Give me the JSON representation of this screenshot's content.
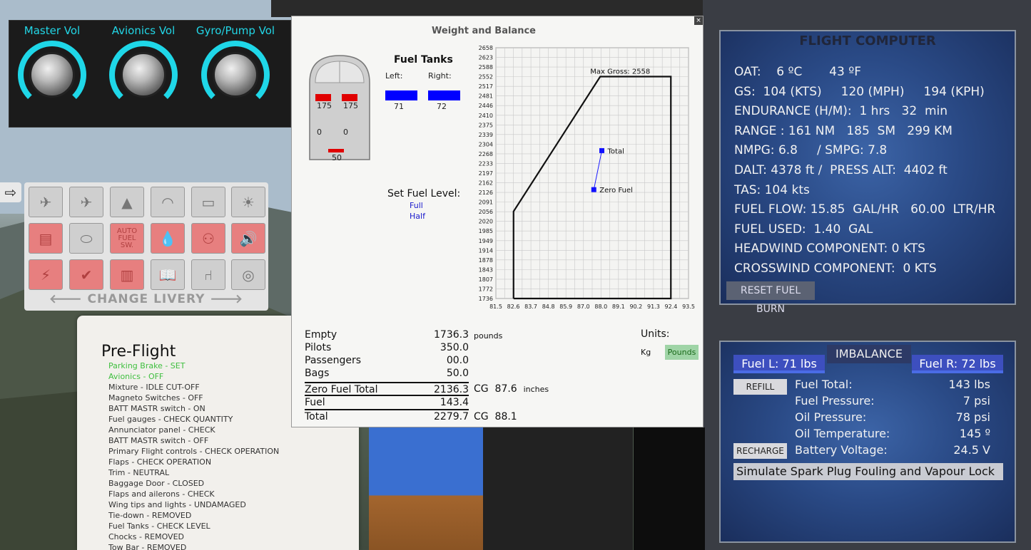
{
  "knobs": [
    {
      "label": "Master Vol"
    },
    {
      "label": "Avionics Vol"
    },
    {
      "label": "Gyro/Pump Vol"
    }
  ],
  "icon_panel": {
    "arrow_tab": "⇨",
    "livery_label": "CHANGE LIVERY",
    "auto_fuel_label": "AUTO\nFUEL\nSW."
  },
  "checklist": {
    "title": "Pre-Flight",
    "items": [
      {
        "text": "Parking Brake - SET",
        "done": true
      },
      {
        "text": "Avionics - OFF",
        "done": true
      },
      {
        "text": "Mixture - IDLE CUT-OFF",
        "done": false
      },
      {
        "text": "Magneto Switches - OFF",
        "done": false
      },
      {
        "text": "BATT MASTR switch - ON",
        "done": false
      },
      {
        "text": "Fuel gauges - CHECK QUANTITY",
        "done": false
      },
      {
        "text": "Annunciator panel - CHECK",
        "done": false
      },
      {
        "text": "BATT MASTR switch - OFF",
        "done": false
      },
      {
        "text": "Primary Flight controls - CHECK OPERATION",
        "done": false
      },
      {
        "text": "Flaps - CHECK OPERATION",
        "done": false
      },
      {
        "text": "Trim - NEUTRAL",
        "done": false
      },
      {
        "text": "Baggage Door - CLOSED",
        "done": false
      },
      {
        "text": "Flaps and ailerons - CHECK",
        "done": false
      },
      {
        "text": "Wing tips and lights - UNDAMAGED",
        "done": false
      },
      {
        "text": "Tie-down - REMOVED",
        "done": false
      },
      {
        "text": "Fuel Tanks - CHECK LEVEL",
        "done": false
      },
      {
        "text": "Chocks - REMOVED",
        "done": false
      },
      {
        "text": "Tow Bar - REMOVED",
        "done": false
      }
    ]
  },
  "wb": {
    "title": "Weight and Balance",
    "close": "×",
    "seats": {
      "pilot_left": "175",
      "pilot_right": "175",
      "pax_left": "0",
      "pax_right": "0",
      "bags": "50"
    },
    "fuel_tanks_title": "Fuel Tanks",
    "left_label": "Left:",
    "right_label": "Right:",
    "left_value": "71",
    "right_value": "72",
    "set_fuel_title": "Set Fuel Level:",
    "full_label": "Full",
    "half_label": "Half",
    "rows": [
      {
        "label": "Empty",
        "value": "1736.3"
      },
      {
        "label": "Pilots",
        "value": "350.0"
      },
      {
        "label": "Passengers",
        "value": "00.0"
      },
      {
        "label": "Bags",
        "value": "50.0"
      },
      {
        "label": "Zero Fuel Total",
        "value": "2136.3"
      },
      {
        "label": "Fuel",
        "value": "143.4"
      },
      {
        "label": "Total",
        "value": "2279.7"
      }
    ],
    "pounds_label": "pounds",
    "cg_label": "CG",
    "zero_fuel_cg": "87.6",
    "inches_label": "inches",
    "total_cg": "88.1",
    "units_label": "Units:",
    "kg_label": "Kg",
    "pounds_button": "Pounds",
    "bar_color": "#0000ff"
  },
  "chart_data": {
    "type": "line",
    "title": "",
    "x_ticks": [
      "81.5",
      "82.6",
      "83.7",
      "84.8",
      "85.9",
      "87.0",
      "88.0",
      "89.1",
      "90.2",
      "91.3",
      "92.4",
      "93.5"
    ],
    "y_ticks": [
      "2658",
      "2623",
      "2588",
      "2552",
      "2517",
      "2481",
      "2446",
      "2410",
      "2375",
      "2339",
      "2304",
      "2268",
      "2233",
      "2197",
      "2162",
      "2126",
      "2091",
      "2056",
      "2020",
      "1985",
      "1949",
      "1914",
      "1878",
      "1843",
      "1807",
      "1772",
      "1736"
    ],
    "xlim": [
      81.5,
      93.5
    ],
    "ylim": [
      1736,
      2658
    ],
    "envelope": {
      "x": [
        82.6,
        82.6,
        88.0,
        92.4,
        92.4,
        82.6
      ],
      "y": [
        1736,
        2056,
        2552,
        2552,
        1736,
        1736
      ]
    },
    "envelope_label": "Max Gross: 2558",
    "points": [
      {
        "name": "Total",
        "x": 88.1,
        "y": 2279.7
      },
      {
        "name": "Zero Fuel",
        "x": 87.6,
        "y": 2136.3
      }
    ],
    "grid": true
  },
  "flight_computer": {
    "title": "FLIGHT COMPUTER",
    "lines": [
      "OAT:    6 ºC       43 ºF",
      "GS:  104 (KTS)     120 (MPH)     194 (KPH)",
      "ENDURANCE (H/M):  1 hrs   32  min",
      "RANGE : 161 NM   185  SM   299 KM",
      "NMPG: 6.8     / SMPG: 7.8",
      "DALT: 4378 ft /  PRESS ALT:  4402 ft",
      "TAS: 104 kts",
      "FUEL FLOW: 15.85  GAL/HR   60.00  LTR/HR",
      "FUEL USED:  1.40  GAL",
      "HEADWIND COMPONENT: 0 KTS",
      "CROSSWIND COMPONENT:  0 KTS"
    ],
    "reset_button": "RESET FUEL BURN"
  },
  "engine": {
    "imbalance": "IMBALANCE",
    "fuel_left": "Fuel L: 71 lbs",
    "fuel_right": "Fuel R: 72 lbs",
    "refill": "REFILL",
    "recharge": "RECHARGE",
    "rows": [
      {
        "label": "Fuel Total:",
        "value": "143 lbs"
      },
      {
        "label": "Fuel Pressure:",
        "value": "7 psi"
      },
      {
        "label": "Oil Pressure:",
        "value": "78 psi"
      },
      {
        "label": "Oil Temperature:",
        "value": "145 º"
      },
      {
        "label": "Battery Voltage:",
        "value": "24.5 V"
      }
    ],
    "spark": "Simulate Spark Plug Fouling and Vapour Lock"
  }
}
